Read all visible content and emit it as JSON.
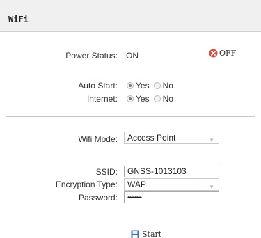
{
  "header": {
    "title": "WiFi"
  },
  "power": {
    "label": "Power Status:",
    "value": "ON",
    "off_button": "OFF"
  },
  "auto_start": {
    "label": "Auto Start:",
    "yes": "Yes",
    "no": "No",
    "selected": "Yes"
  },
  "internet": {
    "label": "Internet:",
    "yes": "Yes",
    "no": "No",
    "selected": "Yes"
  },
  "wifi_mode": {
    "label": "Wifi Mode:",
    "value": "Access Point"
  },
  "ssid": {
    "label": "SSID:",
    "value": "GNSS-1013103"
  },
  "encryption": {
    "label": "Encryption Type:",
    "value": "WAP"
  },
  "password": {
    "label": "Password:",
    "value": "••••••••"
  },
  "start_button": {
    "label": "Start"
  },
  "colors": {
    "off_icon": "#e04a3c",
    "disk_icon": "#3a6fb4"
  }
}
